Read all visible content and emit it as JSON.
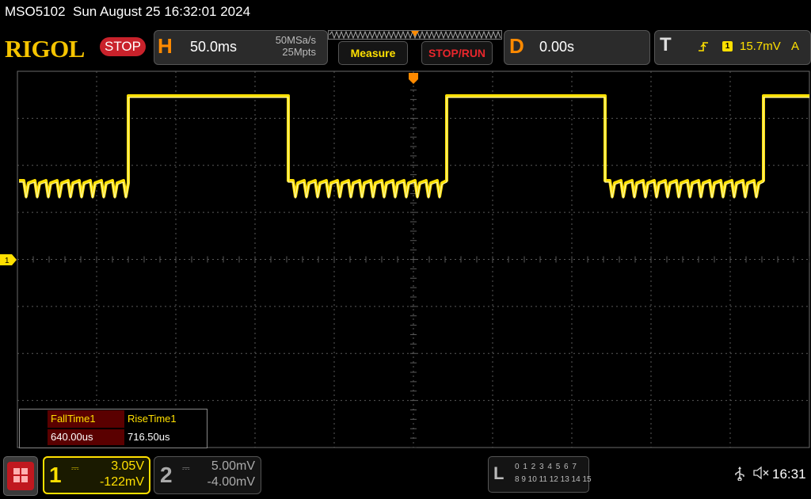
{
  "titlebar": {
    "model": "MSO5102",
    "datetime": "Sun August 25 16:32:01 2024"
  },
  "toolbar": {
    "logo": "RIGOL",
    "run_state": "STOP",
    "horizontal": {
      "letter": "H",
      "timebase": "50.0ms",
      "sample_rate": "50MSa/s",
      "memory_depth": "25Mpts"
    },
    "measure_label": "Measure",
    "stop_run_label": "STOP/RUN",
    "delay": {
      "letter": "D",
      "value": "0.00s"
    },
    "trigger": {
      "letter": "T",
      "source": "1",
      "level": "15.7mV",
      "mode": "A",
      "edge_icon": "rising-edge-icon"
    }
  },
  "display": {
    "grid_divisions": {
      "x": 10,
      "y": 8
    },
    "channel_marker": "1",
    "trace_color": "#ffe000"
  },
  "measurements": {
    "headers": [
      "FallTime1",
      "RiseTime1"
    ],
    "values": [
      "640.00us",
      "716.50us"
    ]
  },
  "channels": [
    {
      "number": "1",
      "scale": "3.05V",
      "offset": "-122mV",
      "coupling_icon": "dc-coupling-icon",
      "active": true
    },
    {
      "number": "2",
      "scale": "5.00mV",
      "offset": "-4.00mV",
      "coupling_icon": "dc-coupling-icon",
      "active": false
    }
  ],
  "logic": {
    "letter": "L",
    "row1": "0 1 2 3  4 5 6 7",
    "row2": "8 9 10 11 12 13 14 15"
  },
  "status": {
    "time": "16:31",
    "usb_icon": "usb-icon",
    "speaker_icon": "speaker-muted-icon"
  },
  "colors": {
    "accent_orange": "#ff8a00",
    "channel1": "#ffe000",
    "stop_red": "#c9222b"
  }
}
